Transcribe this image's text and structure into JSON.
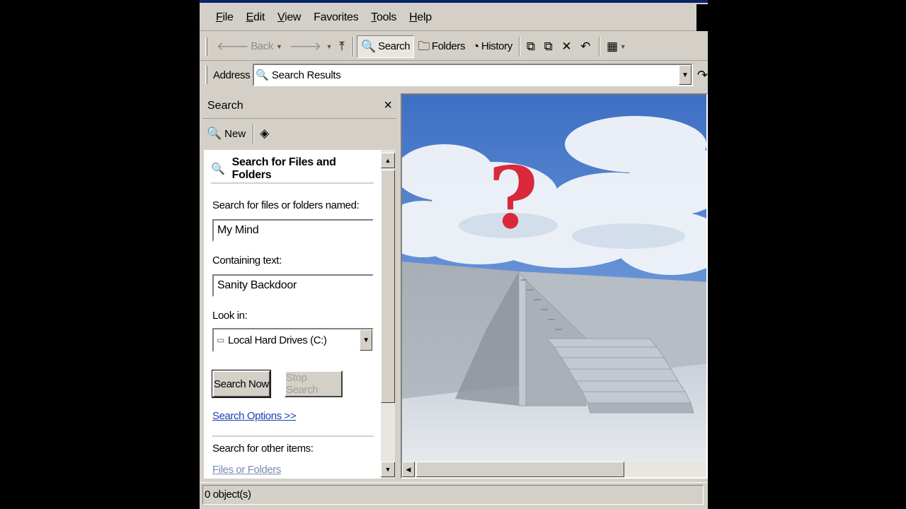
{
  "menu": {
    "items": [
      {
        "u": "F",
        "rest": "ile"
      },
      {
        "u": "E",
        "rest": "dit"
      },
      {
        "u": "V",
        "rest": "iew"
      },
      {
        "u": "F",
        "rest": "avorites",
        "pre": ""
      },
      {
        "u": "T",
        "rest": "ools"
      },
      {
        "u": "H",
        "rest": "elp"
      }
    ]
  },
  "toolbar": {
    "back": "Back",
    "search": "Search",
    "folders": "Folders",
    "history": "History"
  },
  "address": {
    "label": "Address",
    "value": "Search Results"
  },
  "search_pane": {
    "title": "Search",
    "new_label": "New",
    "section_title": "Search for Files and Folders",
    "name_label": "Search for files or folders named:",
    "name_value": "My Mind",
    "text_label": "Containing text:",
    "text_value": "Sanity Backdoor",
    "lookin_label": "Look in:",
    "lookin_value": "Local Hard Drives (C:)",
    "search_now": "Search Now",
    "stop_search": "Stop Search",
    "options_link": "Search Options >>",
    "other_label": "Search for other items:",
    "files_link": "Files or Folders"
  },
  "status": {
    "text": "0 object(s)"
  },
  "colors": {
    "chrome": "#d4d0c8",
    "link": "#1c3fb0",
    "question_mark": "#d8283a"
  }
}
